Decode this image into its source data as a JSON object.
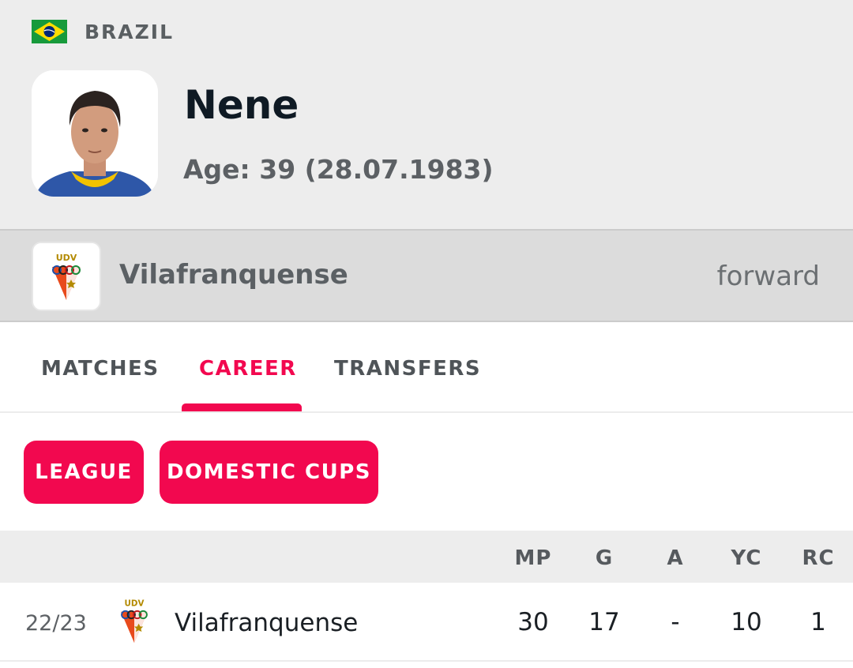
{
  "country": {
    "name": "BRAZIL",
    "flag_icon": "brazil-flag-icon"
  },
  "player": {
    "name": "Nene",
    "age_text": "Age: 39 (28.07.1983)"
  },
  "club": {
    "name": "Vilafranquense",
    "position": "forward",
    "logo_text": "UDV"
  },
  "tabs": [
    {
      "label": "MATCHES",
      "active": false
    },
    {
      "label": "CAREER",
      "active": true
    },
    {
      "label": "TRANSFERS",
      "active": false
    }
  ],
  "filters": [
    {
      "label": "LEAGUE"
    },
    {
      "label": "DOMESTIC CUPS"
    }
  ],
  "table": {
    "columns": [
      "MP",
      "G",
      "A",
      "YC",
      "RC"
    ],
    "rows": [
      {
        "season": "22/23",
        "club": "Vilafranquense",
        "mp": "30",
        "g": "17",
        "a": "-",
        "yc": "10",
        "rc": "1"
      }
    ]
  },
  "colors": {
    "accent": "#f2084f",
    "header_bg": "#ededed",
    "club_bar_bg": "#dcdcdc"
  }
}
